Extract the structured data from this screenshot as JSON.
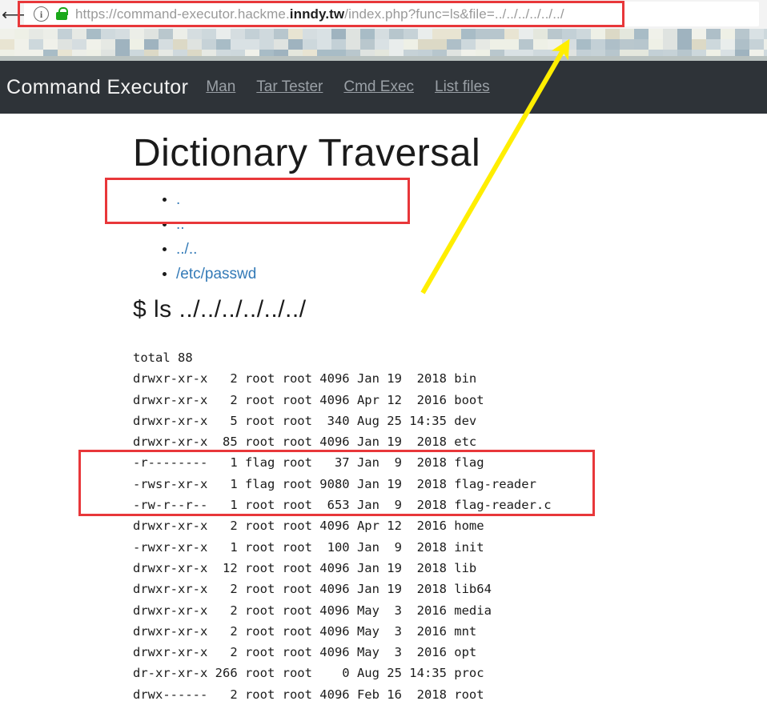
{
  "browser": {
    "back_icon": "back-arrow-icon",
    "info_icon": "info-circle-icon",
    "info_glyph": "i",
    "lock_icon": "green-padlock-icon",
    "url_prefix": "https://command-executor.hackme.",
    "url_domain": "inndy.tw",
    "url_suffix": "/index.php?func=ls&file=../../../../../../",
    "url_full": "https://command-executor.hackme.inndy.tw/index.php?func=ls&file=../../../../../../"
  },
  "navbar": {
    "brand": "Command Executor",
    "links": [
      {
        "label": "Man"
      },
      {
        "label": "Tar Tester"
      },
      {
        "label": "Cmd Exec"
      },
      {
        "label": "List files"
      }
    ]
  },
  "main": {
    "title": "Dictionary Traversal",
    "paths": [
      {
        "label": "."
      },
      {
        "label": ".."
      },
      {
        "label": "../.."
      },
      {
        "label": "/etc/passwd"
      }
    ],
    "command": "$ ls ../../../../../../",
    "listing_header": "total 88",
    "listing": [
      {
        "perms": "drwxr-xr-x",
        "links": "2",
        "owner": "root",
        "group": "root",
        "size": "4096",
        "month": "Jan",
        "day": "19",
        "time": "2018",
        "name": "bin"
      },
      {
        "perms": "drwxr-xr-x",
        "links": "2",
        "owner": "root",
        "group": "root",
        "size": "4096",
        "month": "Apr",
        "day": "12",
        "time": "2016",
        "name": "boot"
      },
      {
        "perms": "drwxr-xr-x",
        "links": "5",
        "owner": "root",
        "group": "root",
        "size": "340",
        "month": "Aug",
        "day": "25",
        "time": "14:35",
        "name": "dev"
      },
      {
        "perms": "drwxr-xr-x",
        "links": "85",
        "owner": "root",
        "group": "root",
        "size": "4096",
        "month": "Jan",
        "day": "19",
        "time": "2018",
        "name": "etc"
      },
      {
        "perms": "-r--------",
        "links": "1",
        "owner": "flag",
        "group": "root",
        "size": "37",
        "month": "Jan",
        "day": "9",
        "time": "2018",
        "name": "flag"
      },
      {
        "perms": "-rwsr-xr-x",
        "links": "1",
        "owner": "flag",
        "group": "root",
        "size": "9080",
        "month": "Jan",
        "day": "19",
        "time": "2018",
        "name": "flag-reader"
      },
      {
        "perms": "-rw-r--r--",
        "links": "1",
        "owner": "root",
        "group": "root",
        "size": "653",
        "month": "Jan",
        "day": "9",
        "time": "2018",
        "name": "flag-reader.c"
      },
      {
        "perms": "drwxr-xr-x",
        "links": "2",
        "owner": "root",
        "group": "root",
        "size": "4096",
        "month": "Apr",
        "day": "12",
        "time": "2016",
        "name": "home"
      },
      {
        "perms": "-rwxr-xr-x",
        "links": "1",
        "owner": "root",
        "group": "root",
        "size": "100",
        "month": "Jan",
        "day": "9",
        "time": "2018",
        "name": "init"
      },
      {
        "perms": "drwxr-xr-x",
        "links": "12",
        "owner": "root",
        "group": "root",
        "size": "4096",
        "month": "Jan",
        "day": "19",
        "time": "2018",
        "name": "lib"
      },
      {
        "perms": "drwxr-xr-x",
        "links": "2",
        "owner": "root",
        "group": "root",
        "size": "4096",
        "month": "Jan",
        "day": "19",
        "time": "2018",
        "name": "lib64"
      },
      {
        "perms": "drwxr-xr-x",
        "links": "2",
        "owner": "root",
        "group": "root",
        "size": "4096",
        "month": "May",
        "day": "3",
        "time": "2016",
        "name": "media"
      },
      {
        "perms": "drwxr-xr-x",
        "links": "2",
        "owner": "root",
        "group": "root",
        "size": "4096",
        "month": "May",
        "day": "3",
        "time": "2016",
        "name": "mnt"
      },
      {
        "perms": "drwxr-xr-x",
        "links": "2",
        "owner": "root",
        "group": "root",
        "size": "4096",
        "month": "May",
        "day": "3",
        "time": "2016",
        "name": "opt"
      },
      {
        "perms": "dr-xr-xr-x",
        "links": "266",
        "owner": "root",
        "group": "root",
        "size": "0",
        "month": "Aug",
        "day": "25",
        "time": "14:35",
        "name": "proc"
      },
      {
        "perms": "drwx------",
        "links": "2",
        "owner": "root",
        "group": "root",
        "size": "4096",
        "month": "Feb",
        "day": "16",
        "time": "2018",
        "name": "root"
      }
    ]
  },
  "annotations": {
    "box_color": "#e8373a",
    "arrow_color": "#ffee00",
    "url_box": "highlights the traversal payload in the address bar",
    "command_box": "highlights the executed ls command",
    "flag_box": "highlights the flag, flag-reader and flag-reader.c entries"
  },
  "colors": {
    "navbar_bg": "#2e3338",
    "navbar_brand": "#f2f2f2",
    "navbar_link": "#9aa0a6",
    "link": "#337ab7",
    "text": "#1b1b1b",
    "lock_green": "#1aa81a"
  }
}
